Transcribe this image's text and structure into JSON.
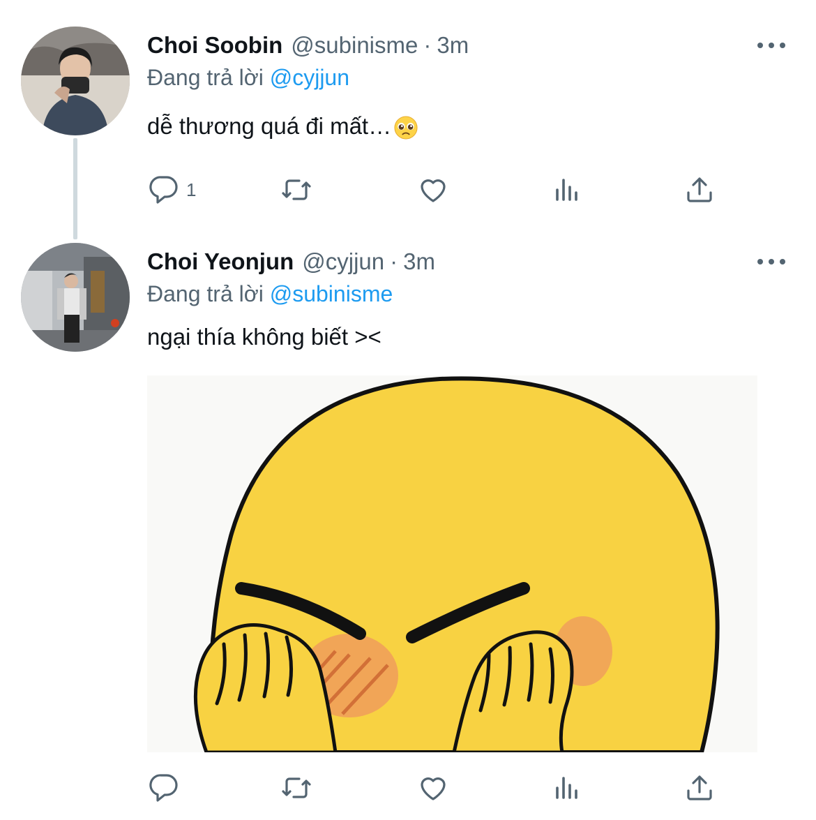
{
  "tweets": [
    {
      "display_name": "Choi Soobin",
      "handle": "@subinisme",
      "separator": "·",
      "time": "3m",
      "replying_prefix": "Đang trả lời",
      "replying_to": "@cyjjun",
      "text": "dễ thương quá đi mất…",
      "emoji": "pleading-face-emoji",
      "reply_count": "1"
    },
    {
      "display_name": "Choi Yeonjun",
      "handle": "@cyjjun",
      "separator": "·",
      "time": "3m",
      "replying_prefix": "Đang trả lời",
      "replying_to": "@subinisme",
      "text": "ngại thía không biết ><",
      "media": "shy-emoji-covering-face-image",
      "reply_count": ""
    }
  ],
  "icons": {
    "reply": "reply-icon",
    "retweet": "retweet-icon",
    "like": "heart-icon",
    "views": "analytics-icon",
    "share": "share-icon",
    "more": "more-icon"
  },
  "colors": {
    "text": "#0f1419",
    "secondary": "#536471",
    "link": "#1d9bf0",
    "thread_line": "#cfd9de",
    "emoji_yellow": "#f8d242",
    "blush": "#f0a05a"
  }
}
